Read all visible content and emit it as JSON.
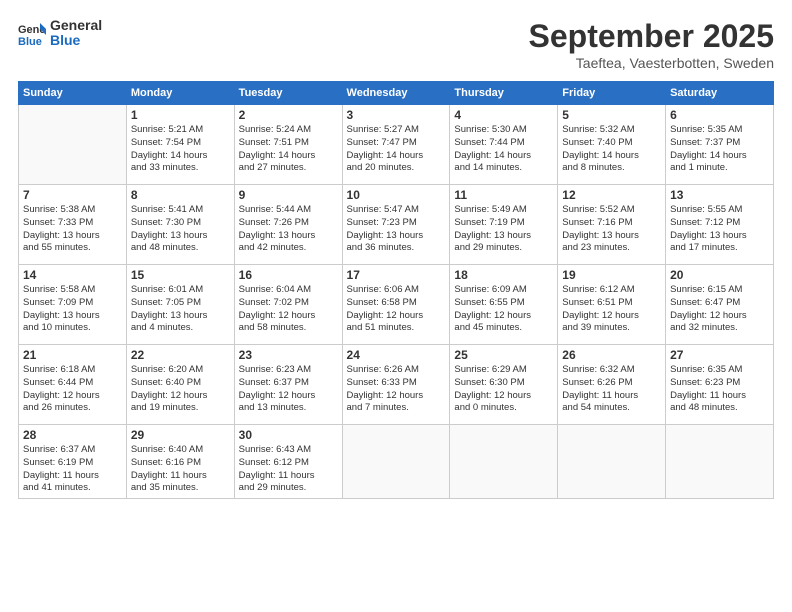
{
  "header": {
    "logo_line1": "General",
    "logo_line2": "Blue",
    "month": "September 2025",
    "location": "Taeftea, Vaesterbotten, Sweden"
  },
  "weekdays": [
    "Sunday",
    "Monday",
    "Tuesday",
    "Wednesday",
    "Thursday",
    "Friday",
    "Saturday"
  ],
  "weeks": [
    [
      {
        "day": "",
        "info": ""
      },
      {
        "day": "1",
        "info": "Sunrise: 5:21 AM\nSunset: 7:54 PM\nDaylight: 14 hours\nand 33 minutes."
      },
      {
        "day": "2",
        "info": "Sunrise: 5:24 AM\nSunset: 7:51 PM\nDaylight: 14 hours\nand 27 minutes."
      },
      {
        "day": "3",
        "info": "Sunrise: 5:27 AM\nSunset: 7:47 PM\nDaylight: 14 hours\nand 20 minutes."
      },
      {
        "day": "4",
        "info": "Sunrise: 5:30 AM\nSunset: 7:44 PM\nDaylight: 14 hours\nand 14 minutes."
      },
      {
        "day": "5",
        "info": "Sunrise: 5:32 AM\nSunset: 7:40 PM\nDaylight: 14 hours\nand 8 minutes."
      },
      {
        "day": "6",
        "info": "Sunrise: 5:35 AM\nSunset: 7:37 PM\nDaylight: 14 hours\nand 1 minute."
      }
    ],
    [
      {
        "day": "7",
        "info": "Sunrise: 5:38 AM\nSunset: 7:33 PM\nDaylight: 13 hours\nand 55 minutes."
      },
      {
        "day": "8",
        "info": "Sunrise: 5:41 AM\nSunset: 7:30 PM\nDaylight: 13 hours\nand 48 minutes."
      },
      {
        "day": "9",
        "info": "Sunrise: 5:44 AM\nSunset: 7:26 PM\nDaylight: 13 hours\nand 42 minutes."
      },
      {
        "day": "10",
        "info": "Sunrise: 5:47 AM\nSunset: 7:23 PM\nDaylight: 13 hours\nand 36 minutes."
      },
      {
        "day": "11",
        "info": "Sunrise: 5:49 AM\nSunset: 7:19 PM\nDaylight: 13 hours\nand 29 minutes."
      },
      {
        "day": "12",
        "info": "Sunrise: 5:52 AM\nSunset: 7:16 PM\nDaylight: 13 hours\nand 23 minutes."
      },
      {
        "day": "13",
        "info": "Sunrise: 5:55 AM\nSunset: 7:12 PM\nDaylight: 13 hours\nand 17 minutes."
      }
    ],
    [
      {
        "day": "14",
        "info": "Sunrise: 5:58 AM\nSunset: 7:09 PM\nDaylight: 13 hours\nand 10 minutes."
      },
      {
        "day": "15",
        "info": "Sunrise: 6:01 AM\nSunset: 7:05 PM\nDaylight: 13 hours\nand 4 minutes."
      },
      {
        "day": "16",
        "info": "Sunrise: 6:04 AM\nSunset: 7:02 PM\nDaylight: 12 hours\nand 58 minutes."
      },
      {
        "day": "17",
        "info": "Sunrise: 6:06 AM\nSunset: 6:58 PM\nDaylight: 12 hours\nand 51 minutes."
      },
      {
        "day": "18",
        "info": "Sunrise: 6:09 AM\nSunset: 6:55 PM\nDaylight: 12 hours\nand 45 minutes."
      },
      {
        "day": "19",
        "info": "Sunrise: 6:12 AM\nSunset: 6:51 PM\nDaylight: 12 hours\nand 39 minutes."
      },
      {
        "day": "20",
        "info": "Sunrise: 6:15 AM\nSunset: 6:47 PM\nDaylight: 12 hours\nand 32 minutes."
      }
    ],
    [
      {
        "day": "21",
        "info": "Sunrise: 6:18 AM\nSunset: 6:44 PM\nDaylight: 12 hours\nand 26 minutes."
      },
      {
        "day": "22",
        "info": "Sunrise: 6:20 AM\nSunset: 6:40 PM\nDaylight: 12 hours\nand 19 minutes."
      },
      {
        "day": "23",
        "info": "Sunrise: 6:23 AM\nSunset: 6:37 PM\nDaylight: 12 hours\nand 13 minutes."
      },
      {
        "day": "24",
        "info": "Sunrise: 6:26 AM\nSunset: 6:33 PM\nDaylight: 12 hours\nand 7 minutes."
      },
      {
        "day": "25",
        "info": "Sunrise: 6:29 AM\nSunset: 6:30 PM\nDaylight: 12 hours\nand 0 minutes."
      },
      {
        "day": "26",
        "info": "Sunrise: 6:32 AM\nSunset: 6:26 PM\nDaylight: 11 hours\nand 54 minutes."
      },
      {
        "day": "27",
        "info": "Sunrise: 6:35 AM\nSunset: 6:23 PM\nDaylight: 11 hours\nand 48 minutes."
      }
    ],
    [
      {
        "day": "28",
        "info": "Sunrise: 6:37 AM\nSunset: 6:19 PM\nDaylight: 11 hours\nand 41 minutes."
      },
      {
        "day": "29",
        "info": "Sunrise: 6:40 AM\nSunset: 6:16 PM\nDaylight: 11 hours\nand 35 minutes."
      },
      {
        "day": "30",
        "info": "Sunrise: 6:43 AM\nSunset: 6:12 PM\nDaylight: 11 hours\nand 29 minutes."
      },
      {
        "day": "",
        "info": ""
      },
      {
        "day": "",
        "info": ""
      },
      {
        "day": "",
        "info": ""
      },
      {
        "day": "",
        "info": ""
      }
    ]
  ]
}
